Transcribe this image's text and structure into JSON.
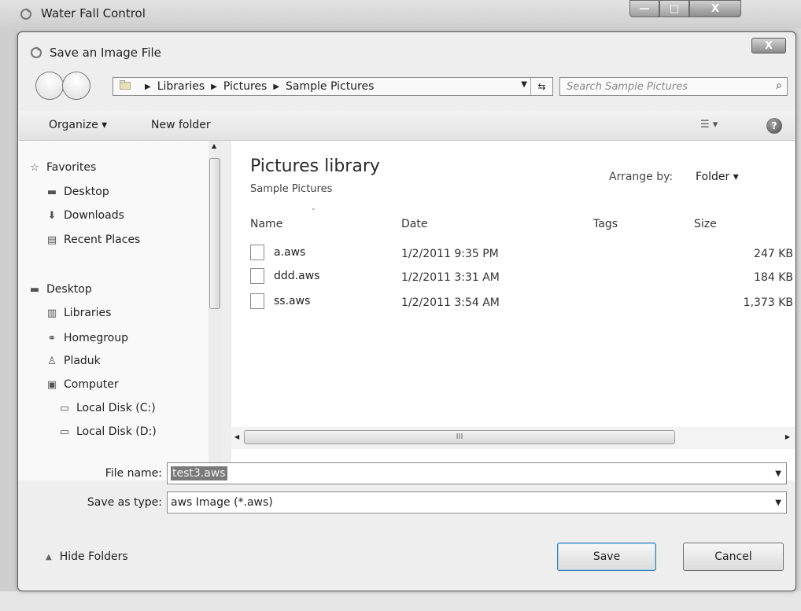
{
  "window": {
    "title": "Water Fall Control",
    "minimize": "—",
    "maximize": "□",
    "close": "X"
  },
  "dialog": {
    "title": "Save an Image File",
    "close": "X"
  },
  "address_bar": {
    "crumbs": [
      "Libraries",
      "Pictures",
      "Sample Pictures"
    ],
    "separator": "▶",
    "dropdown": "▼",
    "refresh": "⇆"
  },
  "search": {
    "placeholder": "Search Sample Pictures",
    "icon": "⌕"
  },
  "toolbar": {
    "organize": "Organize ▾",
    "new_folder": "New folder",
    "views": "☰ ▾",
    "help": "?"
  },
  "nav": {
    "favorites": "Favorites",
    "desktop_fav": "Desktop",
    "downloads": "Downloads",
    "recent_places": "Recent Places",
    "desktop": "Desktop",
    "libraries": "Libraries",
    "homegroup": "Homegroup",
    "user": "Pladuk",
    "computer": "Computer",
    "disk_c": "Local Disk (C:)",
    "disk_d": "Local Disk (D:)",
    "scroll_up": "▲",
    "scroll_down": "▼"
  },
  "content": {
    "library_title": "Pictures library",
    "library_subtitle": "Sample Pictures",
    "arrange_label": "Arrange by:",
    "arrange_value": "Folder ▾",
    "columns": {
      "name": "Name",
      "date": "Date",
      "tags": "Tags",
      "size": "Size"
    },
    "sort_caret": "˄",
    "files": [
      {
        "name": "a.aws",
        "date": "1/2/2011 9:35 PM",
        "size": "247 KB"
      },
      {
        "name": "ddd.aws",
        "date": "1/2/2011 3:31 AM",
        "size": "184 KB"
      },
      {
        "name": "ss.aws",
        "date": "1/2/2011 3:54 AM",
        "size": "1,373 KB"
      }
    ],
    "hscroll_grip": "III",
    "hscroll_left": "◀",
    "hscroll_right": "▶"
  },
  "form": {
    "filename_label": "File name:",
    "filename_value": "test3.aws",
    "filetype_label": "Save as type:",
    "filetype_value": "aws Image (*.aws)",
    "caret": "▼"
  },
  "footer": {
    "hide_folders": "Hide Folders",
    "hide_icon": "▲",
    "save": "Save",
    "cancel": "Cancel"
  }
}
